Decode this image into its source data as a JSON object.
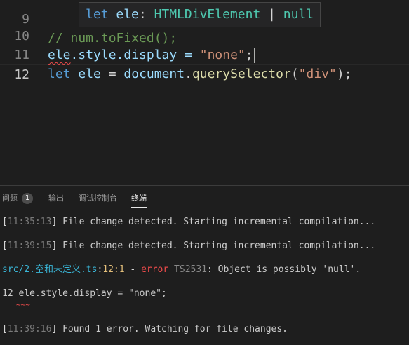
{
  "editor": {
    "lines": [
      {
        "number": "9",
        "comment": "// num.toFixed();"
      },
      {
        "number": "10"
      },
      {
        "number": "11",
        "kw": "let",
        "var": "ele",
        "eq": " = ",
        "obj": "document",
        "dot": ".",
        "fn": "querySelector",
        "open": "(",
        "str": "\"div\"",
        "close": ");"
      },
      {
        "number": "12",
        "var": "ele",
        "rest1": ".style.display = ",
        "str": "\"none\"",
        "semi": ";"
      }
    ],
    "hover": {
      "kw": "let",
      "name": " ele",
      "colon": ": ",
      "type": "HTMLDivElement",
      "pipe": " | ",
      "null": "null"
    }
  },
  "panel": {
    "tabs": [
      {
        "label": "问题",
        "badge": "1"
      },
      {
        "label": "输出"
      },
      {
        "label": "调试控制台"
      },
      {
        "label": "终端"
      }
    ],
    "terminal": {
      "line1": {
        "open": "[",
        "time": "11:35:13",
        "close": "]",
        "msg": " File change detected. Starting incremental compilation..."
      },
      "line2": {
        "open": "[",
        "time": "11:39:15",
        "close": "]",
        "msg": " File change detected. Starting incremental compilation..."
      },
      "line3": {
        "path": "src/2.空和未定义.ts",
        "colon": ":",
        "pos": "12:1",
        "dash": " - ",
        "err": "error",
        "code": " TS2531",
        "msg": ": Object is possibly 'null'."
      },
      "line4": {
        "text": "12 ele.style.display = \"none\";"
      },
      "line5": {
        "tilde": "~~~"
      },
      "line6": {
        "open": "[",
        "time": "11:39:16",
        "close": "]",
        "msg": " Found 1 error. Watching for file changes."
      }
    }
  },
  "colors": {
    "background": "#1e1e1e",
    "error": "#f14c4c",
    "path": "#3ab7d8",
    "keyword": "#569cd6",
    "variable": "#9cdcfe",
    "function": "#dcdcaa",
    "string": "#ce9178",
    "type": "#4ec9b0"
  }
}
